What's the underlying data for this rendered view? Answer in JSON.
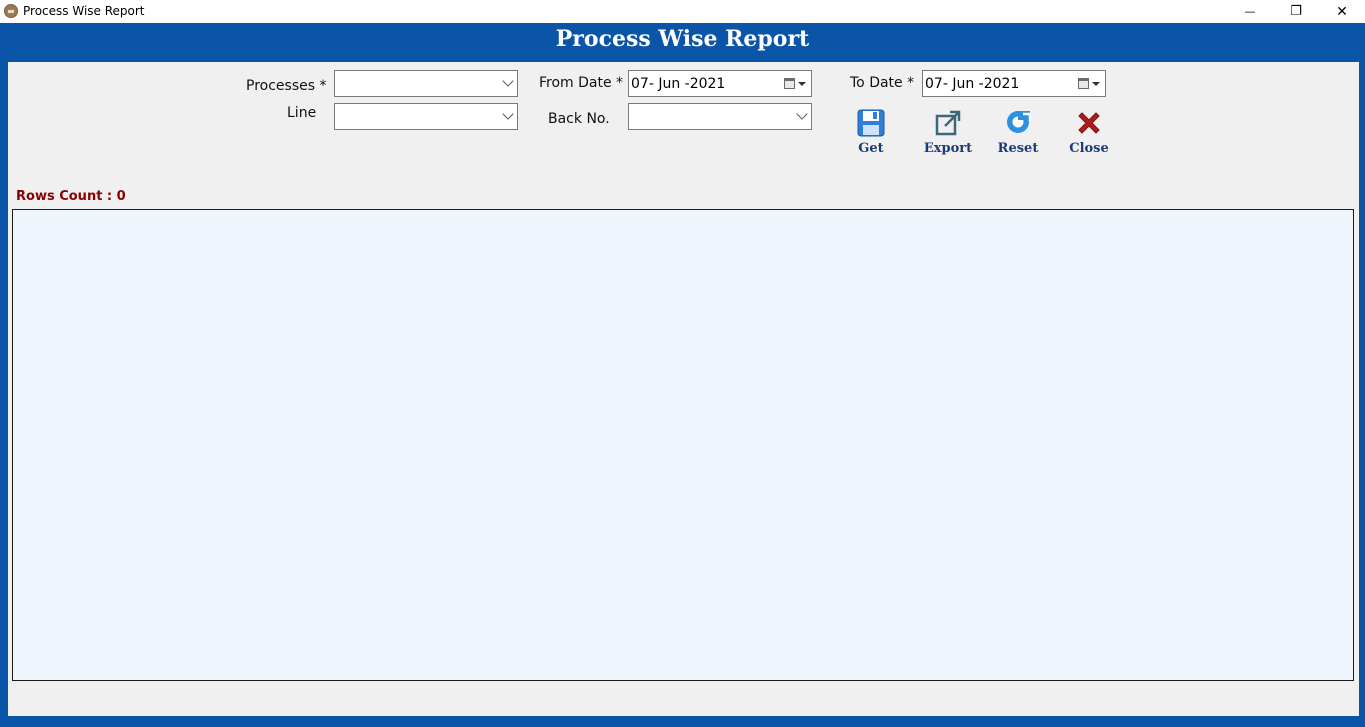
{
  "window": {
    "title": "Process Wise Report",
    "minimize": "—",
    "restore": "❐",
    "close": "✕"
  },
  "header": {
    "title": "Process Wise Report"
  },
  "form": {
    "processes_label": "Processes *",
    "processes_value": "",
    "line_label": "Line",
    "line_value": "",
    "from_date_label": "From Date *",
    "from_date_value": "07- Jun -2021",
    "back_no_label": "Back No.",
    "back_no_value": "",
    "to_date_label": "To Date *",
    "to_date_value": "07- Jun -2021"
  },
  "toolbar": {
    "get_label": "Get",
    "export_label": "Export",
    "reset_label": "Reset",
    "close_label": "Close"
  },
  "grid": {
    "rows_count_label": "Rows Count : 0",
    "rows": []
  },
  "colors": {
    "frame": "#0b55a8",
    "panel": "#f0f0f0",
    "grid_bg": "#eef5fc",
    "rows_count": "#8b0000",
    "button_text": "#1d3a78"
  }
}
